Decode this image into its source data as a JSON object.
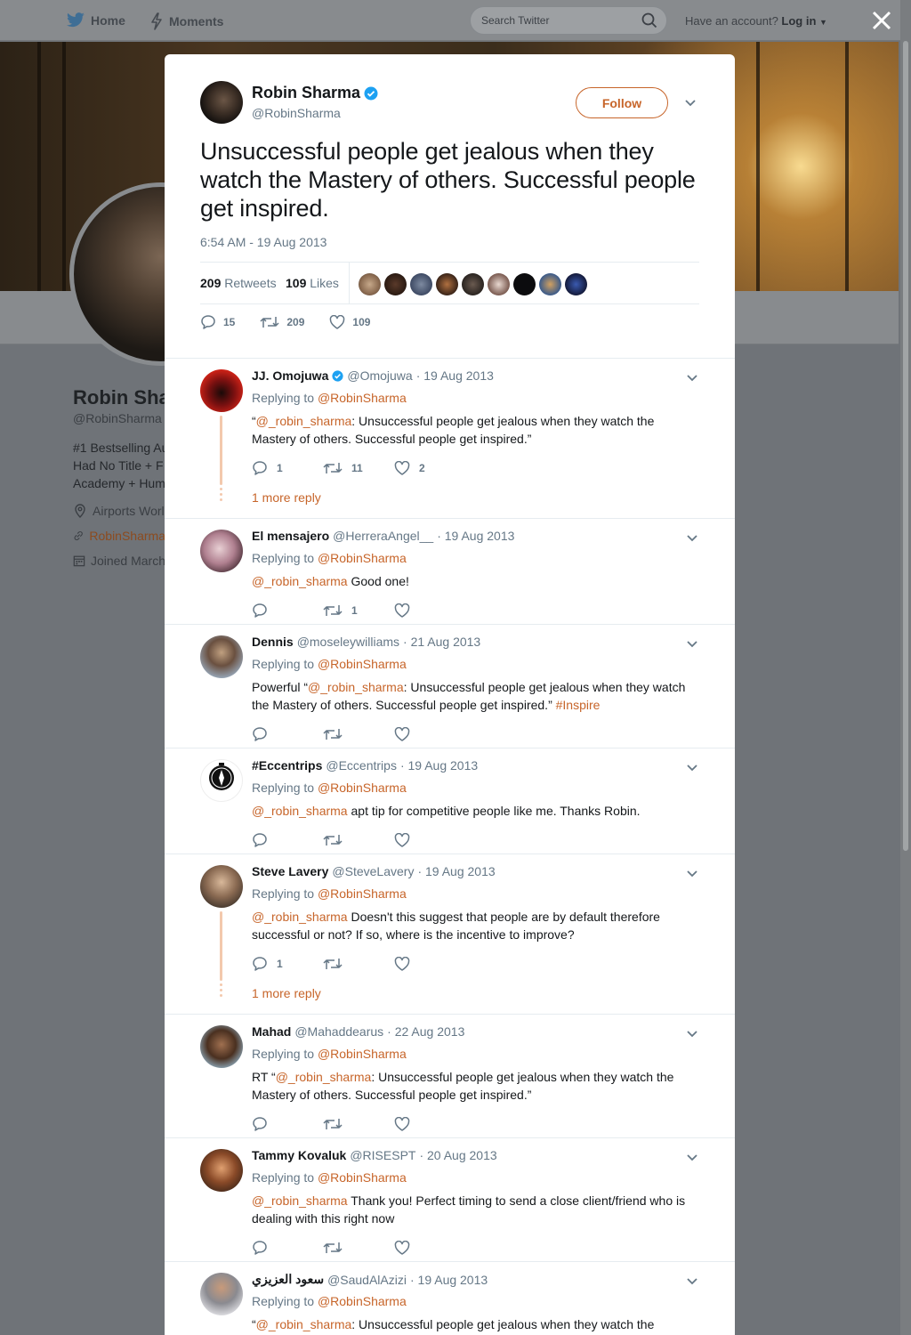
{
  "nav": {
    "home": "Home",
    "moments": "Moments",
    "search_placeholder": "Search Twitter",
    "have_account": "Have an account?",
    "login": "Log in"
  },
  "profile_bg": {
    "name": "Robin Sha",
    "handle": "@RobinSharma",
    "bio_lines": [
      "#1 Bestselling Au",
      "Had No Title + F",
      "Academy + Hum"
    ],
    "location": "Airports Worl",
    "website": "RobinSharma",
    "joined": "Joined March"
  },
  "main_tweet": {
    "name": "Robin Sharma",
    "handle": "@RobinSharma",
    "follow_label": "Follow",
    "text": "Unsuccessful people get jealous when they watch the Mastery of others. Successful people get inspired.",
    "timestamp": "6:54 AM - 19 Aug 2013",
    "retweets_count": "209",
    "retweets_label": "Retweets",
    "likes_count": "109",
    "likes_label": "Likes",
    "reply_count": "15",
    "retweet_count": "209",
    "like_count": "109"
  },
  "replies": [
    {
      "name": "JJ. Omojuwa",
      "verified": true,
      "handle": "@Omojuwa",
      "date": "· 19 Aug 2013",
      "replying_prefix": "Replying to",
      "replying_to": "@RobinSharma",
      "text_parts": [
        "“",
        "@_robin_sharma",
        ": Unsuccessful people get jealous when they watch the Mastery of others. Successful people get inspired.”"
      ],
      "reply_count": "1",
      "retweet_count": "11",
      "like_count": "2",
      "more_reply": "1 more reply"
    },
    {
      "name": "El mensajero",
      "handle": "@HerreraAngel__",
      "date": "· 19 Aug 2013",
      "replying_prefix": "Replying to",
      "replying_to": "@RobinSharma",
      "text_parts": [
        "",
        "@_robin_sharma",
        " Good one!"
      ],
      "reply_count": "",
      "retweet_count": "1",
      "like_count": ""
    },
    {
      "name": "Dennis",
      "handle": "@moseleywilliams",
      "date": "· 21 Aug 2013",
      "replying_prefix": "Replying to",
      "replying_to": "@RobinSharma",
      "text_parts": [
        "Powerful “",
        "@_robin_sharma",
        ": Unsuccessful people get jealous when they watch the Mastery of others. Successful people get inspired.” ",
        "#Inspire"
      ],
      "reply_count": "",
      "retweet_count": "",
      "like_count": ""
    },
    {
      "name": "#Eccentrips",
      "handle": "@Eccentrips",
      "date": "· 19 Aug 2013",
      "replying_prefix": "Replying to",
      "replying_to": "@RobinSharma",
      "text_parts": [
        "",
        "@_robin_sharma",
        " apt tip for competitive people like me. Thanks Robin."
      ],
      "reply_count": "",
      "retweet_count": "",
      "like_count": ""
    },
    {
      "name": "Steve Lavery",
      "handle": "@SteveLavery",
      "date": "· 19 Aug 2013",
      "replying_prefix": "Replying to",
      "replying_to": "@RobinSharma",
      "text_parts": [
        "",
        "@_robin_sharma",
        " Doesn't this suggest that people are by default therefore successful or not? If so, where is the incentive to improve?"
      ],
      "reply_count": "1",
      "retweet_count": "",
      "like_count": "",
      "more_reply": "1 more reply"
    },
    {
      "name": "Mahad",
      "handle": "@Mahaddearus",
      "date": "· 22 Aug 2013",
      "replying_prefix": "Replying to",
      "replying_to": "@RobinSharma",
      "text_parts": [
        "RT “",
        "@_robin_sharma",
        ": Unsuccessful people get jealous when they watch the Mastery of others. Successful people get inspired.”"
      ],
      "reply_count": "",
      "retweet_count": "",
      "like_count": ""
    },
    {
      "name": "Tammy Kovaluk",
      "handle": "@RISESPT",
      "date": "· 20 Aug 2013",
      "replying_prefix": "Replying to",
      "replying_to": "@RobinSharma",
      "text_parts": [
        "",
        "@_robin_sharma",
        " Thank you! Perfect timing to send a close client/friend who is dealing with this right now"
      ],
      "reply_count": "",
      "retweet_count": "",
      "like_count": ""
    },
    {
      "name": "سعود العزيزي",
      "handle": "@SaudAlAzizi",
      "date": "· 19 Aug 2013",
      "replying_prefix": "Replying to",
      "replying_to": "@RobinSharma",
      "text_parts": [
        "“",
        "@_robin_sharma",
        ": Unsuccessful people get jealous when they watch the"
      ],
      "reply_count": "",
      "retweet_count": "",
      "like_count": ""
    }
  ],
  "colors": {
    "accent": "#c7652a",
    "verified": "#1da1f2",
    "muted": "#657786",
    "thread_line": "#f3c9ad"
  }
}
